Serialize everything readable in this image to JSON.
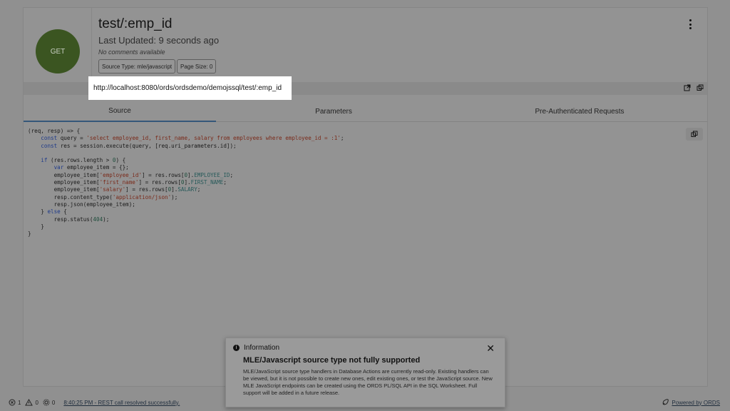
{
  "header": {
    "method": "GET",
    "title": "test/:emp_id",
    "last_updated": "Last Updated: 9 seconds ago",
    "comments": "No comments available",
    "chips": [
      "Source Type: mle/javascript",
      "Page Size: 0"
    ],
    "url": "http://localhost:8080/ords/ordsdemo/demojssql/test/:emp_id"
  },
  "tabs": [
    {
      "label": "Source",
      "active": true
    },
    {
      "label": "Parameters",
      "active": false
    },
    {
      "label": "Pre-Authenticated Requests",
      "active": false
    }
  ],
  "toast": {
    "label": "Information",
    "title": "MLE/Javascript source type not fully supported",
    "body": "MLE/JavaScript source type handlers in Database Actions are currently read-only. Existing handlers can be viewed, but it is not possible to create new ones, edit existing ones, or test the JavaScript source. New MLE JavaScript endpoints can be created using the ORDS PL/SQL API in the SQL Worksheet. Full support will be added in a future release."
  },
  "status": {
    "errors": "1",
    "warnings": "0",
    "settings_count": "0",
    "message": "8:40:25 PM - REST call resolved successfully.",
    "powered": "Powered by ORDS"
  },
  "colors": {
    "method_circle": "#3b5521",
    "tab_underline": "#35577a"
  }
}
